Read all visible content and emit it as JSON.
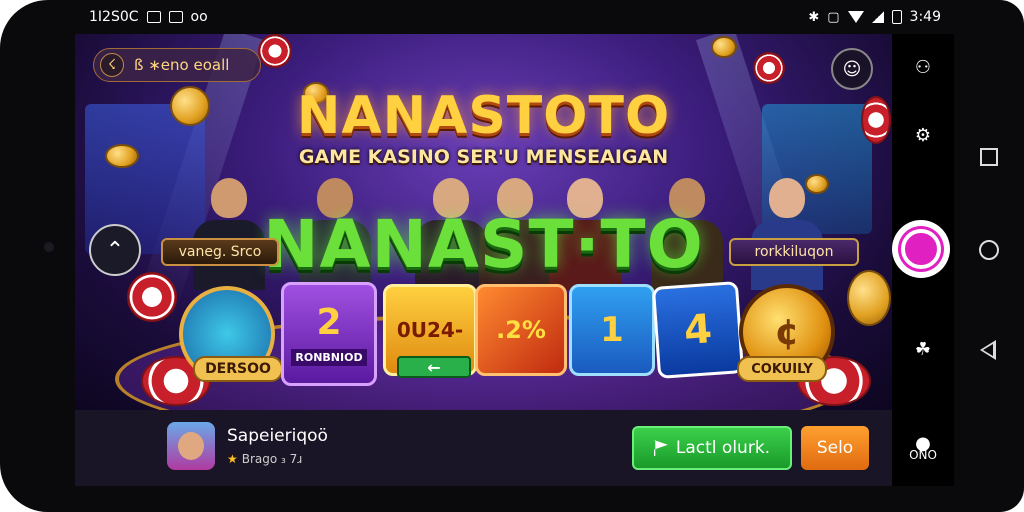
{
  "status_bar": {
    "left_text": "1I2S0C",
    "left_letters": "oo",
    "time": "3:49"
  },
  "game": {
    "top_pill": "ß ∗eno eoall",
    "title_top": "NANASTOTO",
    "subtitle": "GAME KASINO SER'U MENSEAIGAN",
    "title_main": "NANAST·TO",
    "label_left": "vaneg. Srco",
    "label_right": "rorkkiluqon",
    "cards": {
      "avatar_label": "DERSOO",
      "purple_number": "2",
      "purple_caption": "RONBNIOD",
      "yellow_text": "0U24-",
      "orange_text": ".2%",
      "blue_text": "1",
      "cards_text": "4",
      "coin_label": "COKUILY"
    }
  },
  "bottom": {
    "app_name": "Sapeieriqoö",
    "app_meta": "Brago ₃ 7ɹ",
    "green_button": "Lactl olurk.",
    "orange_button": "Selo"
  },
  "sidebar": {
    "bottom_label": "ONO"
  },
  "colors": {
    "accent_green": "#3ad04a",
    "accent_orange": "#ffa030",
    "record_pink": "#e020c0",
    "title_gold": "#ffd040"
  }
}
